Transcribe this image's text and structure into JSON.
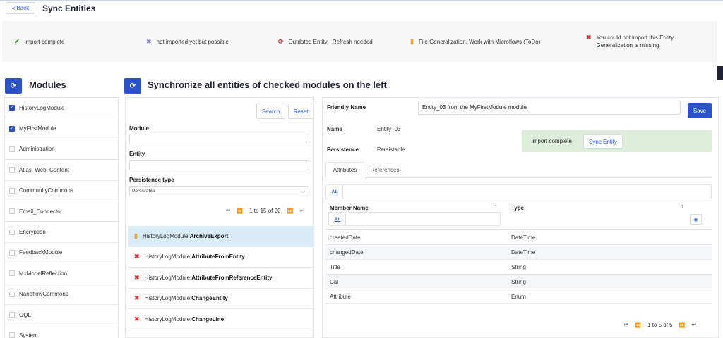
{
  "header": {
    "back_label": "Back",
    "title": "Sync Entities"
  },
  "legend": [
    {
      "icon": "check-icon",
      "glyph": "✔",
      "color": "#3a9a3a",
      "text": "import complete"
    },
    {
      "icon": "x-icon",
      "glyph": "✖",
      "color": "#7a7fd0",
      "text": "not imported yet but possible"
    },
    {
      "icon": "refresh-icon",
      "glyph": "⟳",
      "color": "#d23a3a",
      "text": "Outdated Entity - Refresh needed"
    },
    {
      "icon": "file-icon",
      "glyph": "▮",
      "color": "#e9a43d",
      "text": "File Generalization. Work with Microflows (ToDo)"
    },
    {
      "icon": "x-icon",
      "glyph": "✖",
      "color": "#d23a3a",
      "text": "You could not import this Entity.",
      "text2": "Generalization is missing"
    }
  ],
  "modules": {
    "title": "Modules",
    "items": [
      {
        "label": "HistoryLogModule",
        "checked": true
      },
      {
        "label": "MyFirstModule",
        "checked": true
      },
      {
        "label": "Administration",
        "checked": false
      },
      {
        "label": "Atlas_Web_Content",
        "checked": false
      },
      {
        "label": "CommunityCommons",
        "checked": false
      },
      {
        "label": "Email_Connector",
        "checked": false
      },
      {
        "label": "Encryption",
        "checked": false
      },
      {
        "label": "FeedbackModule",
        "checked": false
      },
      {
        "label": "MxModelReflection",
        "checked": false
      },
      {
        "label": "NanoflowCommons",
        "checked": false
      },
      {
        "label": "OQL",
        "checked": false
      },
      {
        "label": "System",
        "checked": false
      }
    ]
  },
  "sync": {
    "title": "Synchronize all entities of checked modules on the left",
    "search_label": "Search",
    "reset_label": "Reset",
    "module_label": "Module",
    "entity_label": "Entity",
    "persistence_label": "Persistence type",
    "persistence_value": "Persistable",
    "pager_text": "1 to 15 of 20",
    "entities": [
      {
        "prefix": "HistoryLogModule:",
        "name": "ArchiveExport",
        "status": "file",
        "selected": true
      },
      {
        "prefix": "HistoryLogModule:",
        "name": "AttributeFromEntity",
        "status": "error",
        "selected": false
      },
      {
        "prefix": "HistoryLogModule:",
        "name": "AttributeFromReferenceEntity",
        "status": "error",
        "selected": false
      },
      {
        "prefix": "HistoryLogModule:",
        "name": "ChangeEntity",
        "status": "error",
        "selected": false
      },
      {
        "prefix": "HistoryLogModule:",
        "name": "ChangeLine",
        "status": "error",
        "selected": false
      }
    ]
  },
  "detail": {
    "friendly_label": "Friendly Name",
    "friendly_value": "Entity_03 from the MyFirstModule module",
    "save_label": "Save",
    "name_label": "Name",
    "name_value": "Entity_03",
    "persistence_label": "Persistence",
    "persistence_value": "Persistable",
    "status_text": "import complete",
    "sync_label": "Sync Entity",
    "tabs": [
      "Attributes",
      "References"
    ],
    "ab_label": "Ab",
    "col_member": "Member Name",
    "col_type": "Type",
    "rows": [
      {
        "member": "createdDate",
        "type": "DateTime"
      },
      {
        "member": "changedDate",
        "type": "DateTime"
      },
      {
        "member": "Title",
        "type": "String"
      },
      {
        "member": "Cal",
        "type": "String"
      },
      {
        "member": "Attribute",
        "type": "Enum"
      }
    ],
    "pager_text": "1 to 5 of 5"
  }
}
